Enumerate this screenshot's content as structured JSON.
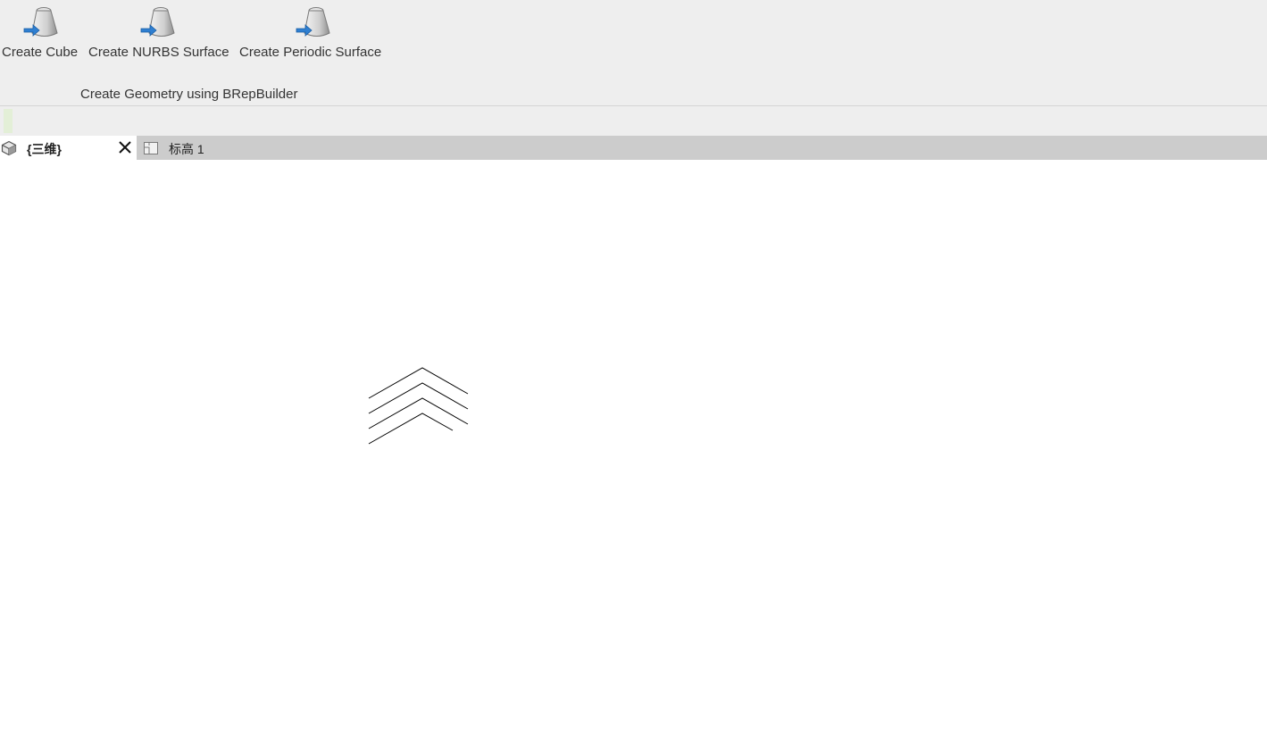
{
  "ribbon": {
    "buttons": [
      {
        "label": "Create Cube",
        "icon": "create-cube-icon"
      },
      {
        "label": "Create NURBS Surface",
        "icon": "create-nurbs-surface-icon"
      },
      {
        "label": "Create Periodic Surface",
        "icon": "create-periodic-surface-icon"
      }
    ],
    "panel_title": "Create Geometry using BRepBuilder"
  },
  "tabs": [
    {
      "label": "{三维}",
      "icon": "3d-view-icon",
      "active": true
    },
    {
      "label": "标高 1",
      "icon": "floor-plan-icon",
      "active": false
    }
  ],
  "colors": {
    "ribbon_bg": "#eeeeee",
    "tabstrip_bg": "#cccccc",
    "viewport_bg": "#ffffff",
    "icon_arrow": "#2f7fd1"
  }
}
